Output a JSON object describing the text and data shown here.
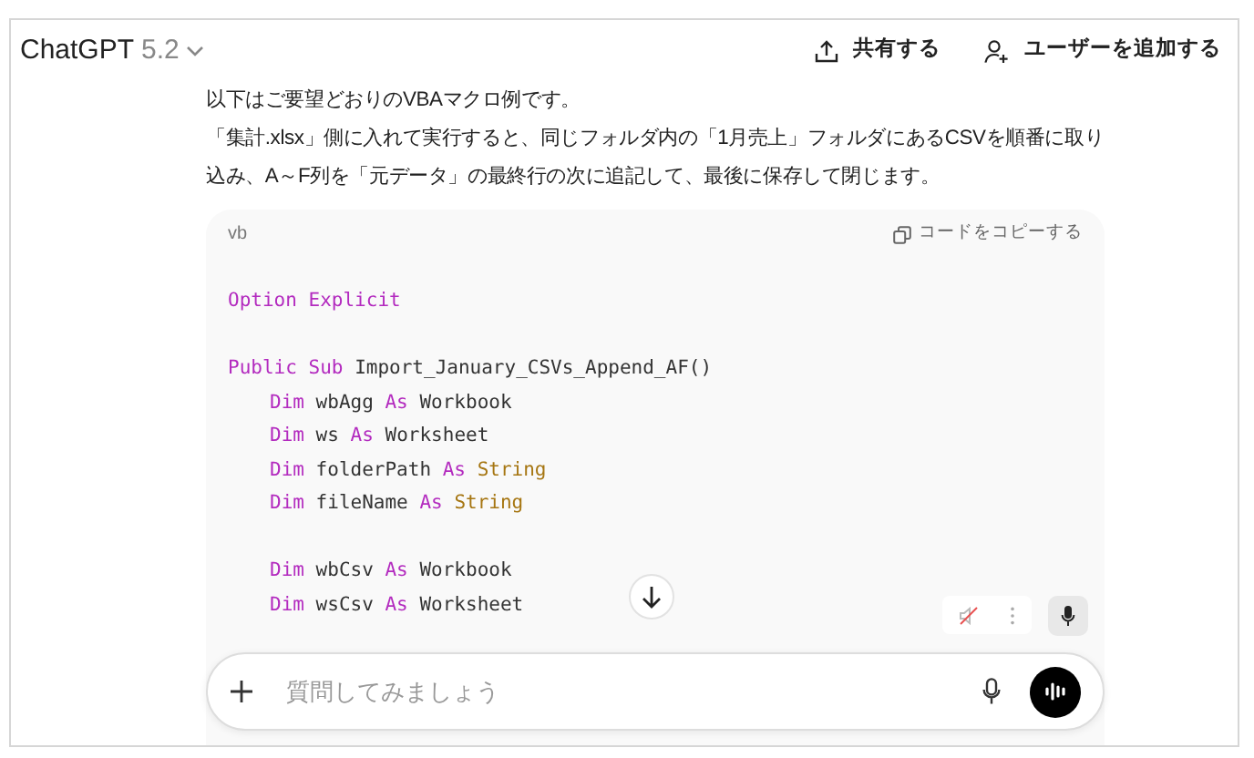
{
  "header": {
    "model_name": "ChatGPT",
    "model_version": "5.2",
    "actions": [
      {
        "kind": "share",
        "label": "共有する"
      },
      {
        "kind": "add-user",
        "label": "ユーザーを追加する"
      }
    ]
  },
  "message": {
    "paragraphs": [
      "以下はご要望どおりのVBAマクロ例です。",
      "「集計.xlsx」側に入れて実行すると、同じフォルダ内の「1月売上」フォルダにあるCSVを順番に取り込み、A～F列を「元データ」の最終行の次に追記して、最後に保存して閉じます。"
    ]
  },
  "code_block": {
    "language": "vb",
    "copy_label": "コードをコピーする",
    "blocks": [
      {
        "lines": [
          {
            "indented": false,
            "tokens": [
              {
                "kind": "keyword",
                "text": "Option"
              },
              {
                "kind": "keyword",
                "text": "Explicit"
              }
            ]
          }
        ]
      },
      {
        "lines": [
          {
            "indented": false,
            "tokens": [
              {
                "kind": "keyword",
                "text": "Public"
              },
              {
                "kind": "keyword",
                "text": "Sub"
              },
              {
                "kind": "plain",
                "text": "Import_January_CSVs_Append_AF()"
              }
            ]
          },
          {
            "indented": true,
            "tokens": [
              {
                "kind": "keyword",
                "text": "Dim"
              },
              {
                "kind": "plain",
                "text": "wbAgg"
              },
              {
                "kind": "keyword",
                "text": "As"
              },
              {
                "kind": "plain",
                "text": "Workbook"
              }
            ]
          },
          {
            "indented": true,
            "tokens": [
              {
                "kind": "keyword",
                "text": "Dim"
              },
              {
                "kind": "plain",
                "text": "ws"
              },
              {
                "kind": "keyword",
                "text": "As"
              },
              {
                "kind": "plain",
                "text": "Worksheet"
              }
            ]
          },
          {
            "indented": true,
            "tokens": [
              {
                "kind": "keyword",
                "text": "Dim"
              },
              {
                "kind": "plain",
                "text": "folderPath"
              },
              {
                "kind": "keyword",
                "text": "As"
              },
              {
                "kind": "type",
                "text": "String"
              }
            ]
          },
          {
            "indented": true,
            "tokens": [
              {
                "kind": "keyword",
                "text": "Dim"
              },
              {
                "kind": "plain",
                "text": "fileName"
              },
              {
                "kind": "keyword",
                "text": "As"
              },
              {
                "kind": "type",
                "text": "String"
              }
            ]
          }
        ]
      },
      {
        "lines": [
          {
            "indented": true,
            "tokens": [
              {
                "kind": "keyword",
                "text": "Dim"
              },
              {
                "kind": "plain",
                "text": "wbCsv"
              },
              {
                "kind": "keyword",
                "text": "As"
              },
              {
                "kind": "plain",
                "text": "Workbook"
              }
            ]
          },
          {
            "indented": true,
            "tokens": [
              {
                "kind": "keyword",
                "text": "Dim"
              },
              {
                "kind": "plain",
                "text": "wsCsv"
              },
              {
                "kind": "keyword",
                "text": "As"
              },
              {
                "kind": "plain",
                "text": "Worksheet"
              }
            ]
          }
        ]
      }
    ]
  },
  "composer": {
    "placeholder": "質問してみましょう"
  }
}
